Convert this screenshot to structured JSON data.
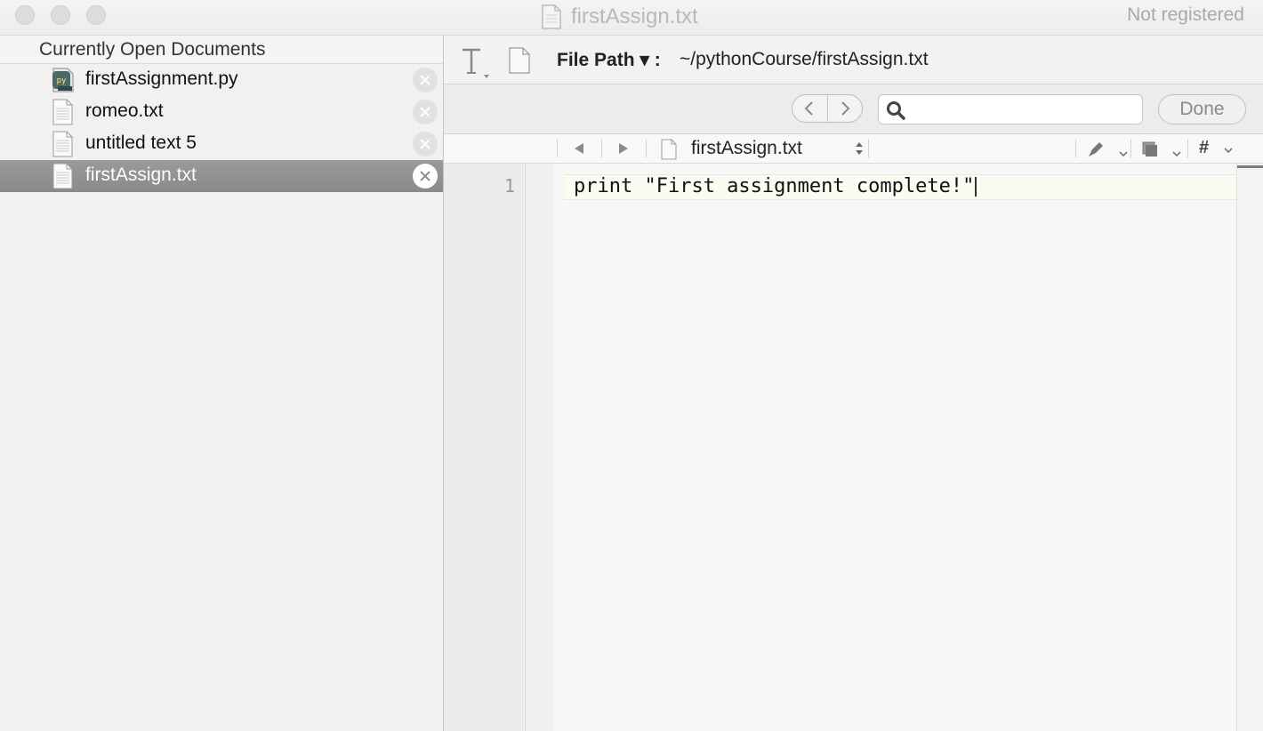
{
  "window": {
    "title": "firstAssign.txt",
    "status": "Not registered"
  },
  "sidebar": {
    "header": "Currently Open Documents",
    "documents": [
      {
        "name": "firstAssignment.py",
        "icon": "python-file-icon",
        "selected": false
      },
      {
        "name": "romeo.txt",
        "icon": "text-file-icon",
        "selected": false
      },
      {
        "name": "untitled text 5",
        "icon": "text-file-icon",
        "selected": false
      },
      {
        "name": "firstAssign.txt",
        "icon": "text-file-icon",
        "selected": true
      }
    ]
  },
  "navbar": {
    "file_path_label": "File Path ▾ :",
    "file_path_value": "~/pythonCourse/firstAssign.txt"
  },
  "find": {
    "search_placeholder": "",
    "done_label": "Done"
  },
  "jumpbar": {
    "file_name": "firstAssign.txt",
    "hash_label": "#"
  },
  "editor": {
    "line_numbers": [
      "1"
    ],
    "lines": [
      "print \"First assignment complete!\""
    ]
  },
  "colors": {
    "selection": "#8f8f8f",
    "background": "#f6f6f6"
  }
}
